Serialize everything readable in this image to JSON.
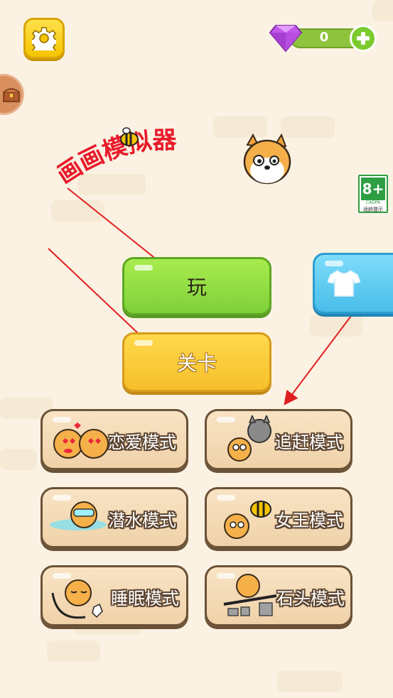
{
  "header": {
    "gem_count": "0"
  },
  "age_rating": {
    "value": "8+",
    "org": "CADPA",
    "caption": "适龄提示"
  },
  "logo": {
    "title": "画画模拟器"
  },
  "main": {
    "play_label": "玩",
    "levels_label": "关卡"
  },
  "modes": [
    {
      "label": "恋爱模式"
    },
    {
      "label": "追赶模式"
    },
    {
      "label": "潜水模式"
    },
    {
      "label": "女王模式"
    },
    {
      "label": "睡眠模式"
    },
    {
      "label": "石头模式"
    }
  ],
  "colors": {
    "background": "#fbf2e3",
    "play_green": "#8fdc41",
    "level_yellow": "#f9c934",
    "shirt_blue": "#5ccbf2",
    "mode_tan": "#f4dab5",
    "arrow_red": "#e02020"
  }
}
